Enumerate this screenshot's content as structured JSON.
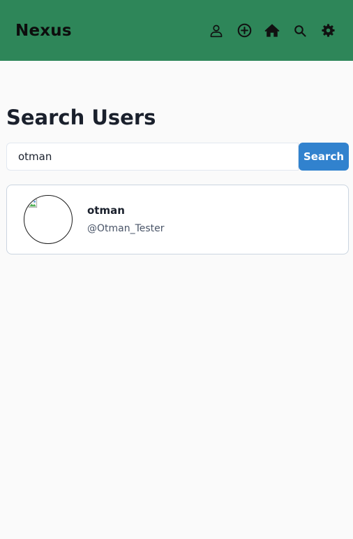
{
  "navbar": {
    "brand": "Nexus",
    "icons": [
      "user-icon",
      "add-circle-icon",
      "home-icon",
      "search-icon",
      "gear-icon"
    ]
  },
  "page": {
    "title": "Search Users"
  },
  "search": {
    "value": "otman",
    "button_label": "Search"
  },
  "results": [
    {
      "name": "otman",
      "handle": "@Otman_Tester"
    }
  ],
  "colors": {
    "navbar_bg": "#2e8659",
    "button_bg": "#3182ce",
    "page_bg": "#fafafa"
  }
}
